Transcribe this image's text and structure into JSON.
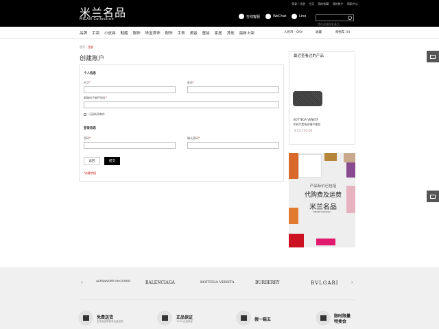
{
  "header": {
    "logo_cn": "米兰名品",
    "logo_en": "MILAN Collection",
    "top_links": [
      "登录 / 注册",
      "主页",
      "我的收藏",
      "我的账户",
      "帮助中心"
    ],
    "services": [
      {
        "label": "在线客服",
        "icon": "headset-icon"
      },
      {
        "label": "WeChat",
        "icon": "wechat-icon"
      },
      {
        "label": "Line",
        "icon": "line-icon"
      }
    ],
    "search_placeholder": "請在這裡搜索產品..."
  },
  "nav": {
    "items": [
      "品牌",
      "手袋",
      "小皮具",
      "鞋履",
      "服饰",
      "珠宝首饰",
      "配饰",
      "手表",
      "美容",
      "童装",
      "家居",
      "其他",
      "最新上架"
    ],
    "currency": "人民币 - CNY",
    "wishlist": "收藏",
    "cart": "购物车 (0)"
  },
  "breadcrumb": {
    "home": "首页",
    "current": "注册"
  },
  "page_title": "创建账户",
  "form": {
    "personal_title": "个人信息",
    "firstname_label": "名字",
    "lastname_label": "姓氏",
    "email_label": "邮箱电子邮件地址",
    "required_mark": "*",
    "newsletter_label": "订阅新闻邮件",
    "login_title": "登录信息",
    "password_label": "密码",
    "confirm_label": "确认密码",
    "back_button": "返回",
    "submit_button": "提交",
    "required_note": "*必要字段"
  },
  "recent": {
    "title": "最近查看过的产品",
    "brand": "BOTTEGA VENETA",
    "name": "KNOT黑色织锦手拿包",
    "price": "￥13,750.00"
  },
  "banner": {
    "line1": "产品标价已包括",
    "line2": "代购费及运费",
    "logo_cn": "米兰名品",
    "logo_en": "MILAN Collection"
  },
  "brands": [
    "ALEXANDER McQUEEN",
    "BALENCIAGA",
    "BOTTEGA VENETA",
    "BURBERRY",
    "BVLGARI"
  ],
  "carousel": {
    "prev": "‹",
    "next": "›"
  },
  "features": [
    {
      "title": "免费送货",
      "subtitle": "全场免回邮费有免费送货",
      "icon": "truck-icon"
    },
    {
      "title": "正品保证",
      "subtitle": "100%正品保证",
      "icon": "certificate-icon"
    },
    {
      "title": "假一赔五",
      "subtitle": "",
      "icon": "shield-icon"
    },
    {
      "title": "限时限量",
      "title2": "特卖会",
      "subtitle": "",
      "icon": "calendar-icon"
    }
  ]
}
